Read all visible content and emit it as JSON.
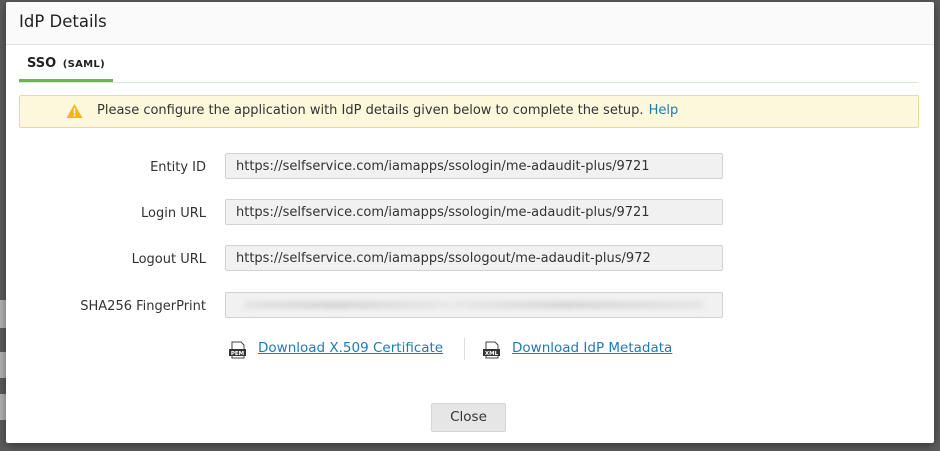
{
  "dialog": {
    "title": "IdP Details"
  },
  "tab": {
    "label": "SSO",
    "sub": "(SAML)"
  },
  "alert": {
    "icon": "warning-icon",
    "message": "Please configure the application with IdP details given below to complete the setup.",
    "help_label": "Help"
  },
  "fields": {
    "entity_id": {
      "label": "Entity ID",
      "value": "https://selfservice.com/iamapps/ssologin/me-adaudit-plus/9721"
    },
    "login_url": {
      "label": "Login URL",
      "value": "https://selfservice.com/iamapps/ssologin/me-adaudit-plus/9721"
    },
    "logout_url": {
      "label": "Logout URL",
      "value": "https://selfservice.com/iamapps/ssologout/me-adaudit-plus/972"
    },
    "fingerprint": {
      "label": "SHA256 FingerPrint",
      "value": ""
    }
  },
  "downloads": {
    "certificate": {
      "icon_text": "PEM",
      "label": "Download X.509 Certificate"
    },
    "metadata": {
      "icon_text": "XML",
      "label": "Download IdP Metadata"
    }
  },
  "footer": {
    "close_label": "Close"
  },
  "colors": {
    "accent_green": "#6cb356",
    "link_blue": "#1f7ab5",
    "alert_bg": "#fcf8dc",
    "warning": "#f0b41c"
  }
}
